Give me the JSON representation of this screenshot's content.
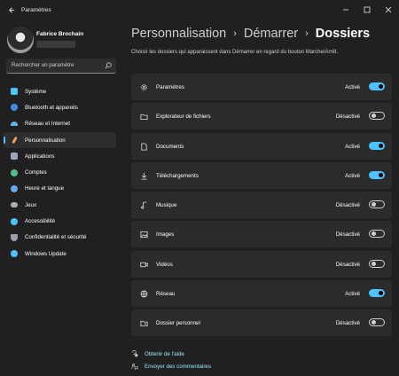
{
  "window": {
    "title": "Paramètres",
    "controls": [
      "minimize-icon",
      "maximize-icon",
      "close-icon"
    ]
  },
  "user": {
    "name": "Fabrice Brochain"
  },
  "search": {
    "placeholder": "Rechercher un paramètre"
  },
  "sidebar": {
    "items": [
      {
        "label": "Système",
        "icon": "monitor-icon",
        "color": "#4cc2ff",
        "active": false
      },
      {
        "label": "Bluetooth et appareils",
        "icon": "bluetooth-icon",
        "color": "#3b8eea",
        "active": false
      },
      {
        "label": "Réseau et Internet",
        "icon": "wifi-icon",
        "color": "#5fb4e8",
        "active": false
      },
      {
        "label": "Personnalisation",
        "icon": "brush-icon",
        "color": "#f0a050",
        "active": true
      },
      {
        "label": "Applications",
        "icon": "apps-icon",
        "color": "#9aa8b8",
        "active": false
      },
      {
        "label": "Comptes",
        "icon": "person-icon",
        "color": "#4fc08d",
        "active": false
      },
      {
        "label": "Heure et langue",
        "icon": "globe-clock-icon",
        "color": "#6aa8f0",
        "active": false
      },
      {
        "label": "Jeux",
        "icon": "gamepad-icon",
        "color": "#b0b0b0",
        "active": false
      },
      {
        "label": "Accessibilité",
        "icon": "accessibility-icon",
        "color": "#4cc2ff",
        "active": false
      },
      {
        "label": "Confidentialité et sécurité",
        "icon": "shield-icon",
        "color": "#9aa0a8",
        "active": false
      },
      {
        "label": "Windows Update",
        "icon": "update-icon",
        "color": "#4cc2ff",
        "active": false
      }
    ]
  },
  "breadcrumb": {
    "items": [
      "Personnalisation",
      "Démarrer"
    ],
    "current": "Dossiers"
  },
  "description": "Choisir les dossiers qui apparaissent dans Démarrer en regard du bouton Marche/Arrêt.",
  "folders": [
    {
      "label": "Paramètres",
      "icon": "gear-icon",
      "state": "Activé",
      "on": true
    },
    {
      "label": "Explorateur de fichiers",
      "icon": "folder-icon",
      "state": "Désactivé",
      "on": false
    },
    {
      "label": "Documents",
      "icon": "document-icon",
      "state": "Activé",
      "on": true
    },
    {
      "label": "Téléchargements",
      "icon": "download-icon",
      "state": "Activé",
      "on": true
    },
    {
      "label": "Musique",
      "icon": "music-icon",
      "state": "Désactivé",
      "on": false
    },
    {
      "label": "Images",
      "icon": "image-icon",
      "state": "Désactivé",
      "on": false
    },
    {
      "label": "Vidéos",
      "icon": "video-icon",
      "state": "Désactivé",
      "on": false
    },
    {
      "label": "Réseau",
      "icon": "network-icon",
      "state": "Activé",
      "on": true
    },
    {
      "label": "Dossier personnel",
      "icon": "user-folder-icon",
      "state": "Désactivé",
      "on": false
    }
  ],
  "links": [
    {
      "label": "Obtenir de l'aide",
      "icon": "help-icon"
    },
    {
      "label": "Envoyer des commentaires",
      "icon": "feedback-icon"
    }
  ],
  "colors": {
    "accent": "#4cc2ff",
    "link": "#99ebff",
    "card": "#2b2b2b",
    "background": "#202020"
  }
}
